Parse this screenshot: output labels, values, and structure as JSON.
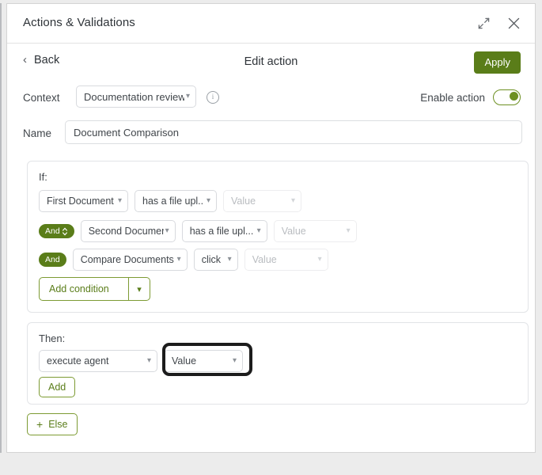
{
  "window": {
    "title": "Actions & Validations",
    "expand_icon": "expand-diagonal-icon",
    "close_icon": "close-x-icon"
  },
  "subheader": {
    "back_label": "Back",
    "back_icon": "chevron-left-icon",
    "page_title": "Edit action",
    "apply_label": "Apply",
    "apply_color": "#5a7d19"
  },
  "context": {
    "label": "Context",
    "selected": "Documentation review",
    "info_icon": "info-circle-icon",
    "enable_label": "Enable action",
    "enable_state": "on",
    "toggle_color": "#6d9022"
  },
  "name": {
    "label": "Name",
    "value": "Document Comparison",
    "placeholder": "Name"
  },
  "if_section": {
    "label": "If:",
    "conditions": [
      {
        "operator": "",
        "subject": "First Document",
        "predicate": "has a file upl...",
        "value": "Value",
        "value_disabled": true
      },
      {
        "operator": "And",
        "operator_has_selector": true,
        "subject": "Second Document",
        "predicate": "has a file upl...",
        "value": "Value",
        "value_disabled": true
      },
      {
        "operator": "And",
        "operator_has_selector": false,
        "subject": "Compare Documents",
        "predicate": "click",
        "value": "Value",
        "value_disabled": true
      }
    ],
    "add_condition_label": "Add condition",
    "add_condition_split_icon": "chevron-down-icon"
  },
  "then_section": {
    "label": "Then:",
    "action": "execute agent",
    "value": "Value",
    "value_focused": true,
    "add_label": "Add"
  },
  "else_button": {
    "label": "Else",
    "icon": "plus-icon"
  }
}
